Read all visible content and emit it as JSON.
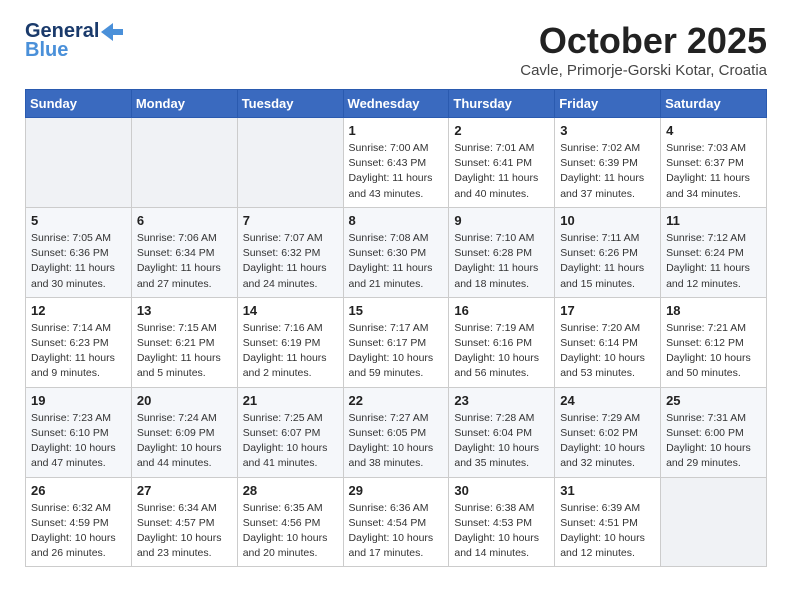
{
  "header": {
    "logo_general": "General",
    "logo_blue": "Blue",
    "month_title": "October 2025",
    "subtitle": "Cavle, Primorje-Gorski Kotar, Croatia"
  },
  "weekdays": [
    "Sunday",
    "Monday",
    "Tuesday",
    "Wednesday",
    "Thursday",
    "Friday",
    "Saturday"
  ],
  "weeks": [
    [
      {
        "day": "",
        "info": ""
      },
      {
        "day": "",
        "info": ""
      },
      {
        "day": "",
        "info": ""
      },
      {
        "day": "1",
        "info": "Sunrise: 7:00 AM\nSunset: 6:43 PM\nDaylight: 11 hours\nand 43 minutes."
      },
      {
        "day": "2",
        "info": "Sunrise: 7:01 AM\nSunset: 6:41 PM\nDaylight: 11 hours\nand 40 minutes."
      },
      {
        "day": "3",
        "info": "Sunrise: 7:02 AM\nSunset: 6:39 PM\nDaylight: 11 hours\nand 37 minutes."
      },
      {
        "day": "4",
        "info": "Sunrise: 7:03 AM\nSunset: 6:37 PM\nDaylight: 11 hours\nand 34 minutes."
      }
    ],
    [
      {
        "day": "5",
        "info": "Sunrise: 7:05 AM\nSunset: 6:36 PM\nDaylight: 11 hours\nand 30 minutes."
      },
      {
        "day": "6",
        "info": "Sunrise: 7:06 AM\nSunset: 6:34 PM\nDaylight: 11 hours\nand 27 minutes."
      },
      {
        "day": "7",
        "info": "Sunrise: 7:07 AM\nSunset: 6:32 PM\nDaylight: 11 hours\nand 24 minutes."
      },
      {
        "day": "8",
        "info": "Sunrise: 7:08 AM\nSunset: 6:30 PM\nDaylight: 11 hours\nand 21 minutes."
      },
      {
        "day": "9",
        "info": "Sunrise: 7:10 AM\nSunset: 6:28 PM\nDaylight: 11 hours\nand 18 minutes."
      },
      {
        "day": "10",
        "info": "Sunrise: 7:11 AM\nSunset: 6:26 PM\nDaylight: 11 hours\nand 15 minutes."
      },
      {
        "day": "11",
        "info": "Sunrise: 7:12 AM\nSunset: 6:24 PM\nDaylight: 11 hours\nand 12 minutes."
      }
    ],
    [
      {
        "day": "12",
        "info": "Sunrise: 7:14 AM\nSunset: 6:23 PM\nDaylight: 11 hours\nand 9 minutes."
      },
      {
        "day": "13",
        "info": "Sunrise: 7:15 AM\nSunset: 6:21 PM\nDaylight: 11 hours\nand 5 minutes."
      },
      {
        "day": "14",
        "info": "Sunrise: 7:16 AM\nSunset: 6:19 PM\nDaylight: 11 hours\nand 2 minutes."
      },
      {
        "day": "15",
        "info": "Sunrise: 7:17 AM\nSunset: 6:17 PM\nDaylight: 10 hours\nand 59 minutes."
      },
      {
        "day": "16",
        "info": "Sunrise: 7:19 AM\nSunset: 6:16 PM\nDaylight: 10 hours\nand 56 minutes."
      },
      {
        "day": "17",
        "info": "Sunrise: 7:20 AM\nSunset: 6:14 PM\nDaylight: 10 hours\nand 53 minutes."
      },
      {
        "day": "18",
        "info": "Sunrise: 7:21 AM\nSunset: 6:12 PM\nDaylight: 10 hours\nand 50 minutes."
      }
    ],
    [
      {
        "day": "19",
        "info": "Sunrise: 7:23 AM\nSunset: 6:10 PM\nDaylight: 10 hours\nand 47 minutes."
      },
      {
        "day": "20",
        "info": "Sunrise: 7:24 AM\nSunset: 6:09 PM\nDaylight: 10 hours\nand 44 minutes."
      },
      {
        "day": "21",
        "info": "Sunrise: 7:25 AM\nSunset: 6:07 PM\nDaylight: 10 hours\nand 41 minutes."
      },
      {
        "day": "22",
        "info": "Sunrise: 7:27 AM\nSunset: 6:05 PM\nDaylight: 10 hours\nand 38 minutes."
      },
      {
        "day": "23",
        "info": "Sunrise: 7:28 AM\nSunset: 6:04 PM\nDaylight: 10 hours\nand 35 minutes."
      },
      {
        "day": "24",
        "info": "Sunrise: 7:29 AM\nSunset: 6:02 PM\nDaylight: 10 hours\nand 32 minutes."
      },
      {
        "day": "25",
        "info": "Sunrise: 7:31 AM\nSunset: 6:00 PM\nDaylight: 10 hours\nand 29 minutes."
      }
    ],
    [
      {
        "day": "26",
        "info": "Sunrise: 6:32 AM\nSunset: 4:59 PM\nDaylight: 10 hours\nand 26 minutes."
      },
      {
        "day": "27",
        "info": "Sunrise: 6:34 AM\nSunset: 4:57 PM\nDaylight: 10 hours\nand 23 minutes."
      },
      {
        "day": "28",
        "info": "Sunrise: 6:35 AM\nSunset: 4:56 PM\nDaylight: 10 hours\nand 20 minutes."
      },
      {
        "day": "29",
        "info": "Sunrise: 6:36 AM\nSunset: 4:54 PM\nDaylight: 10 hours\nand 17 minutes."
      },
      {
        "day": "30",
        "info": "Sunrise: 6:38 AM\nSunset: 4:53 PM\nDaylight: 10 hours\nand 14 minutes."
      },
      {
        "day": "31",
        "info": "Sunrise: 6:39 AM\nSunset: 4:51 PM\nDaylight: 10 hours\nand 12 minutes."
      },
      {
        "day": "",
        "info": ""
      }
    ]
  ]
}
